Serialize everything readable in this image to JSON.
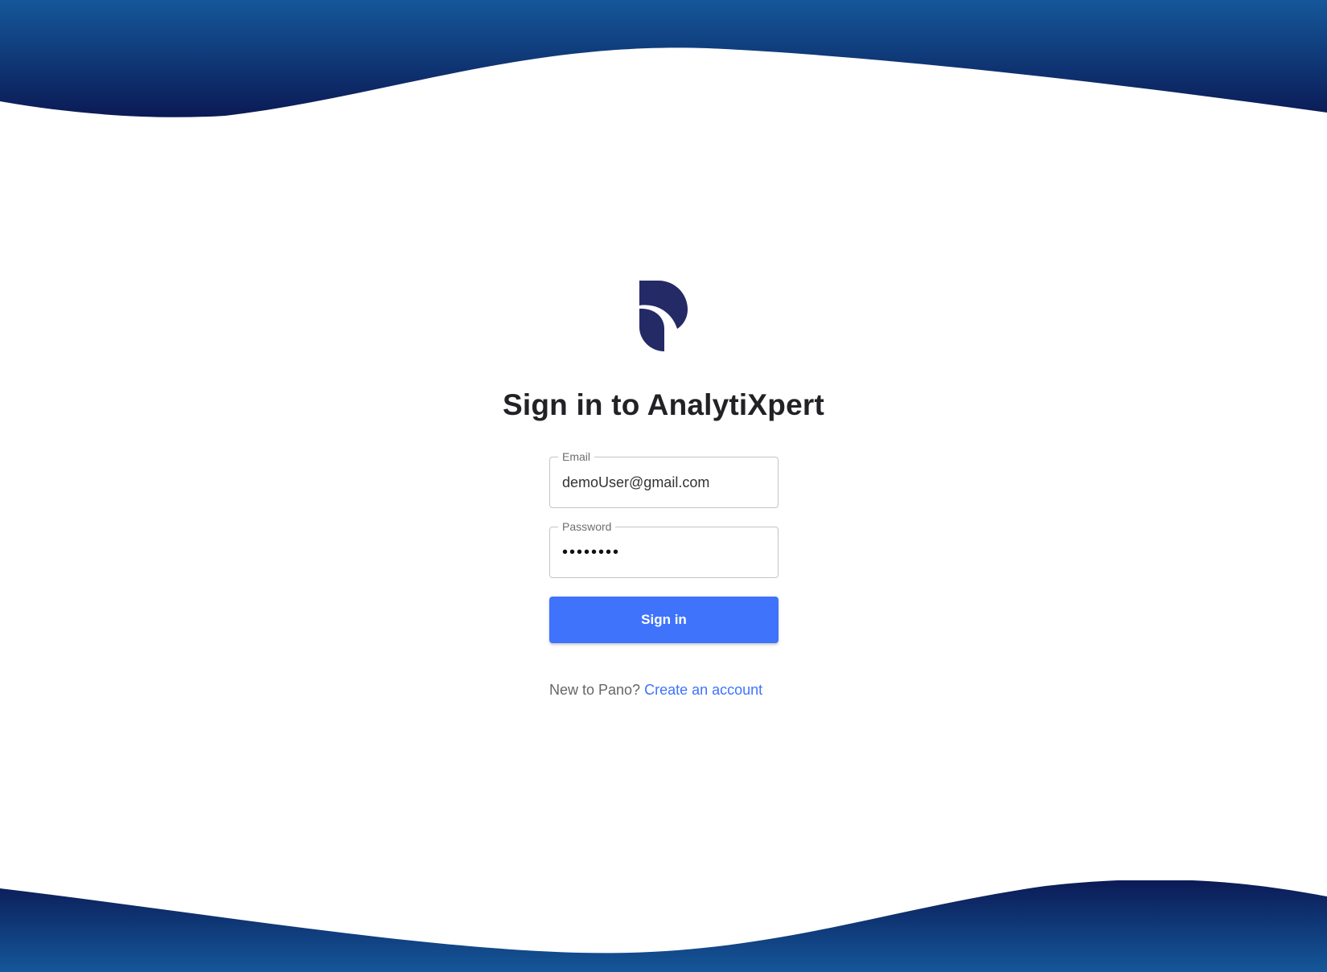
{
  "app": {
    "heading": "Sign in to AnalytiXpert",
    "logo_icon": "pano-logo-icon",
    "brand_color": "#242a66"
  },
  "form": {
    "email": {
      "label": "Email",
      "value": "demoUser@gmail.com"
    },
    "password": {
      "label": "Password",
      "value": "password"
    },
    "submit_label": "Sign in",
    "submit_color": "#3f73fc"
  },
  "footer": {
    "prompt": "New to Pano?",
    "link_label": "Create an account",
    "link_color": "#3f73fc"
  },
  "decor": {
    "wave_colors": [
      "#14579a",
      "#0b1a55"
    ]
  }
}
